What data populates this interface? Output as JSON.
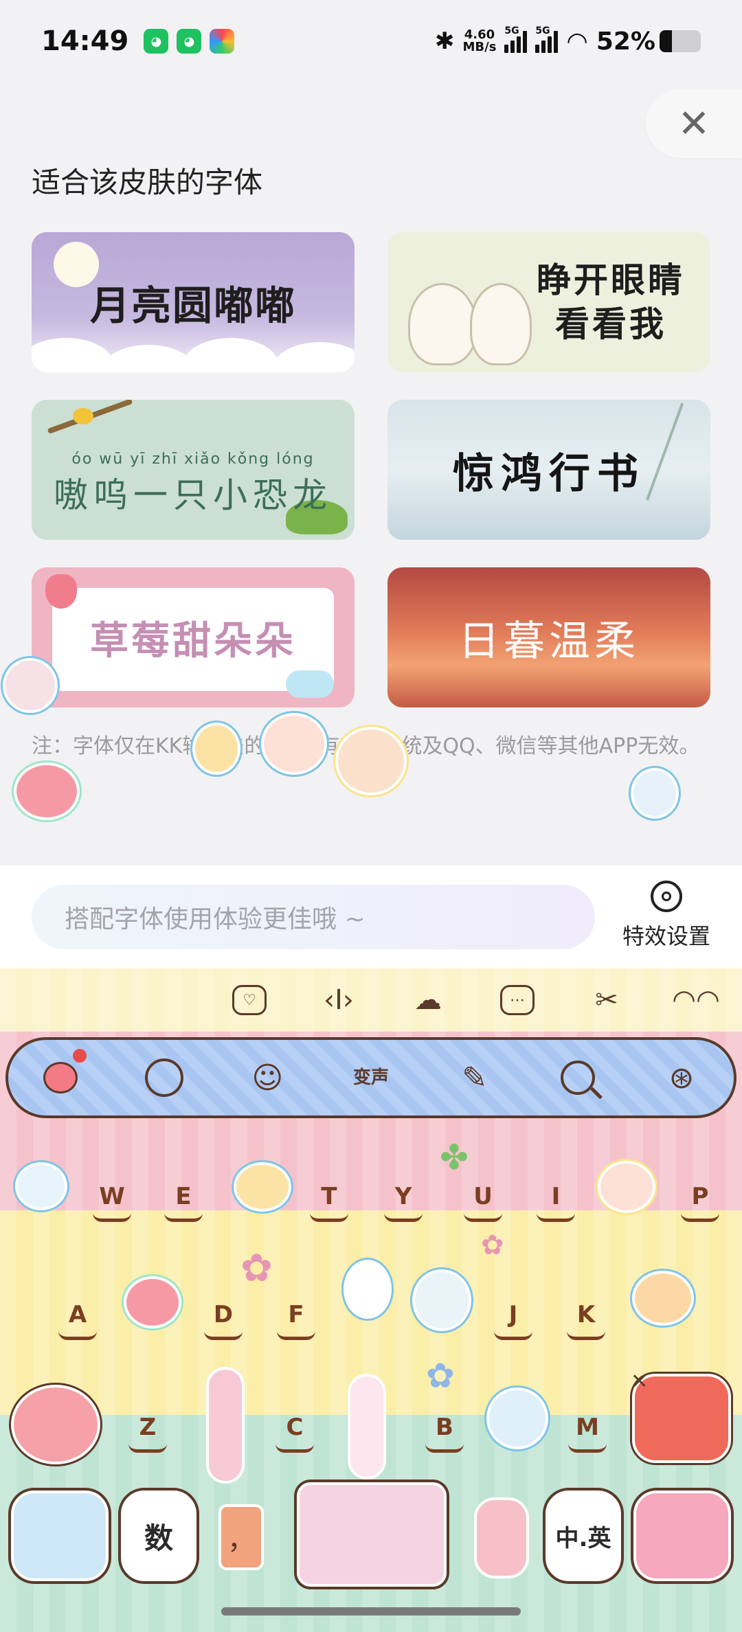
{
  "status_bar": {
    "time": "14:49",
    "network_speed_value": "4.60",
    "network_speed_unit": "MB/s",
    "signal_1": "5G",
    "signal_2": "5G",
    "battery": "52%"
  },
  "header": {
    "section_title": "适合该皮肤的字体"
  },
  "font_cards": [
    {
      "label": "月亮圆嘟嘟"
    },
    {
      "label_line1": "睁开眼睛",
      "label_line2": "看看我"
    },
    {
      "pinyin": "óo wū yī zhī xiǎo kǒng lóng",
      "label": "嗷呜一只小恐龙"
    },
    {
      "label": "惊鸿行书"
    },
    {
      "label": "草莓甜朵朵"
    },
    {
      "label": "日暮温柔"
    }
  ],
  "note": "注：字体仅在KK输入法的 … 内有效，系统及QQ、微信等其他APP无效。",
  "input": {
    "placeholder": "搭配字体使用体验更佳哦 ~",
    "effect_settings": "特效设置"
  },
  "keyboard": {
    "function_bar": {
      "voice_change": "变声"
    },
    "row1": [
      "W",
      "E",
      "T",
      "Y",
      "U",
      "I",
      "P"
    ],
    "row2": [
      "A",
      "D",
      "F",
      "J",
      "K"
    ],
    "row3": [
      "Z",
      "C",
      "B",
      "M"
    ],
    "num_key": "数",
    "comma_key": "，",
    "lang_key": "中.英"
  },
  "colors": {
    "func_bar": "#a9c6f2",
    "key_text": "#7a3e22",
    "row_pink": "#f5c2cc",
    "row_yellow": "#fbeea9",
    "row_green": "#bfe4d3"
  }
}
